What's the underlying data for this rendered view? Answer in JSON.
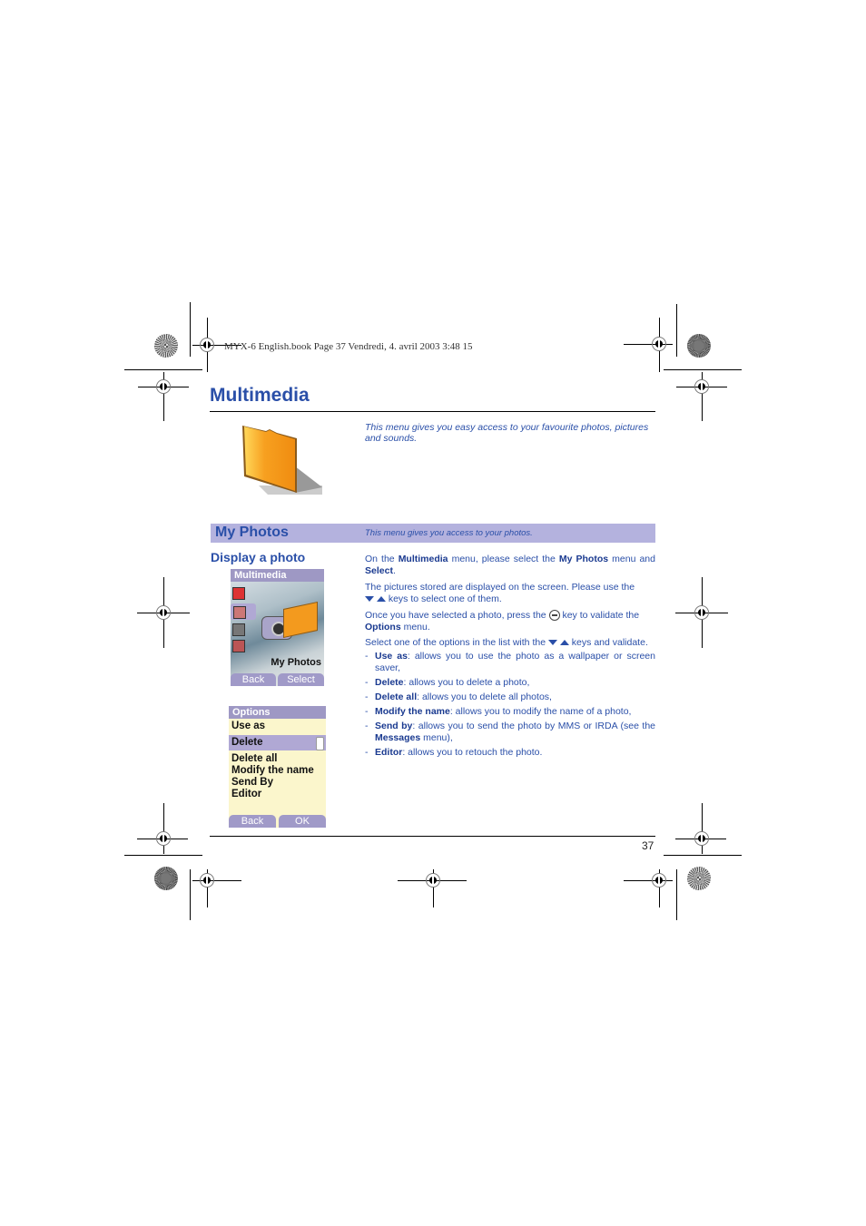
{
  "print_header": "MYX-6 English.book  Page 37  Vendredi, 4. avril 2003  3:48 15",
  "page_title": "Multimedia",
  "intro_text": "This menu gives you easy access to your favourite photos, pictures and sounds.",
  "section": {
    "title": "My Photos",
    "subtitle": "This menu gives you access to your photos."
  },
  "subsection_title": "Display a photo",
  "phone_screen_1": {
    "title": "Multimedia",
    "caption": "My Photos",
    "softkey_left": "Back",
    "softkey_right": "Select"
  },
  "phone_screen_2": {
    "title": "Options",
    "items": [
      "Use as",
      "Delete",
      "Delete all",
      "Modify the name",
      "Send By",
      "Editor"
    ],
    "selected_index": 1,
    "softkey_left": "Back",
    "softkey_right": "OK"
  },
  "instructions": {
    "p1_a": "On the ",
    "p1_b": "Multimedia",
    "p1_c": " menu, please select the ",
    "p1_d": "My Photos",
    "p1_e": " menu and ",
    "p1_f": "Select",
    "p1_g": ".",
    "p2_a": "The pictures stored are displayed on the screen. Please use the",
    "p2_b": " keys to select one of them.",
    "p3_a": "Once you have selected a photo, press the ",
    "p3_b": " key to validate the ",
    "p3_c": "Options",
    "p3_d": " menu.",
    "p4_a": "Select one of the options in the list with the ",
    "p4_b": " keys and validate.",
    "options": [
      {
        "term": "Use as",
        "desc": ": allows you to use the photo as a wallpaper or screen saver,"
      },
      {
        "term": "Delete",
        "desc": ": allows you to delete a photo,"
      },
      {
        "term": "Delete all",
        "desc": ": allows you to delete all photos,"
      },
      {
        "term": "Modify the name",
        "desc": ": allows you to modify the name of a photo,"
      },
      {
        "term": "Send by",
        "desc": ": allows you to send the photo by MMS or IRDA (see the ",
        "term2": "Messages",
        "desc2": " menu),"
      },
      {
        "term": "Editor",
        "desc": ": allows you to retouch the photo."
      }
    ]
  },
  "page_number": "37",
  "colors": {
    "accent": "#2a4fa8",
    "band": "#b4b2de",
    "screen_title": "#9e98c4",
    "options_bg": "#fbf6cc"
  }
}
